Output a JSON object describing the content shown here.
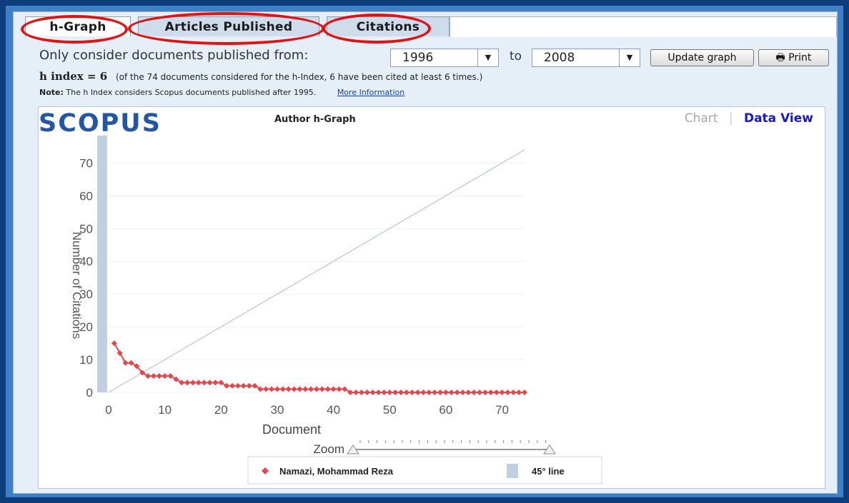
{
  "tabs": [
    {
      "label": "h-Graph",
      "active": true
    },
    {
      "label": "Articles Published",
      "active": false
    },
    {
      "label": "Citations",
      "active": false
    }
  ],
  "filter": {
    "label": "Only consider documents published from:",
    "from": "1996",
    "to_label": "to",
    "to": "2008",
    "update_label": "Update graph",
    "print_label": "Print"
  },
  "hindex": {
    "label": "h index = 6",
    "detail": "(of the 74 documents considered for the h-Index, 6 have been cited at least 6 times.)"
  },
  "note": {
    "label": "Note:",
    "text": "The h Index considers Scopus documents published after 1995.",
    "link": "More Information"
  },
  "chart_header": {
    "logo": "SCOPUS",
    "title": "Author h-Graph",
    "chart_tab": "Chart",
    "data_view_tab": "Data View"
  },
  "chart_data": {
    "type": "scatter",
    "title": "Author h-Graph",
    "xlabel": "Document",
    "ylabel": "Number of Citations",
    "xlim": [
      0,
      74
    ],
    "ylim": [
      0,
      74
    ],
    "xticks": [
      0,
      10,
      20,
      30,
      40,
      50,
      60,
      70
    ],
    "yticks": [
      0,
      10,
      20,
      30,
      40,
      50,
      60,
      70
    ],
    "series": [
      {
        "name": "Namazi, Mohammad Reza",
        "color": "#e8454a",
        "x": [
          1,
          2,
          3,
          4,
          5,
          6,
          7,
          8,
          9,
          10,
          11,
          12,
          13,
          14,
          15,
          16,
          17,
          18,
          19,
          20,
          21,
          22,
          23,
          24,
          25,
          26,
          27,
          28,
          29,
          30,
          31,
          32,
          33,
          34,
          35,
          36,
          37,
          38,
          39,
          40,
          41,
          42,
          43,
          44,
          45,
          46,
          47,
          48,
          49,
          50,
          51,
          52,
          53,
          54,
          55,
          56,
          57,
          58,
          59,
          60,
          61,
          62,
          63,
          64,
          65,
          66,
          67,
          68,
          69,
          70,
          71,
          72,
          73,
          74
        ],
        "y": [
          15,
          12,
          9,
          9,
          8,
          6,
          5,
          5,
          5,
          5,
          5,
          4,
          3,
          3,
          3,
          3,
          3,
          3,
          3,
          3,
          2,
          2,
          2,
          2,
          2,
          2,
          1,
          1,
          1,
          1,
          1,
          1,
          1,
          1,
          1,
          1,
          1,
          1,
          1,
          1,
          1,
          1,
          0,
          0,
          0,
          0,
          0,
          0,
          0,
          0,
          0,
          0,
          0,
          0,
          0,
          0,
          0,
          0,
          0,
          0,
          0,
          0,
          0,
          0,
          0,
          0,
          0,
          0,
          0,
          0,
          0,
          0,
          0,
          0
        ]
      },
      {
        "name": "45° line",
        "color": "#c2cfe0",
        "x": [
          0,
          74
        ],
        "y": [
          0,
          74
        ]
      }
    ],
    "grid": true,
    "legend": "bottom"
  },
  "zoom_label": "Zoom"
}
